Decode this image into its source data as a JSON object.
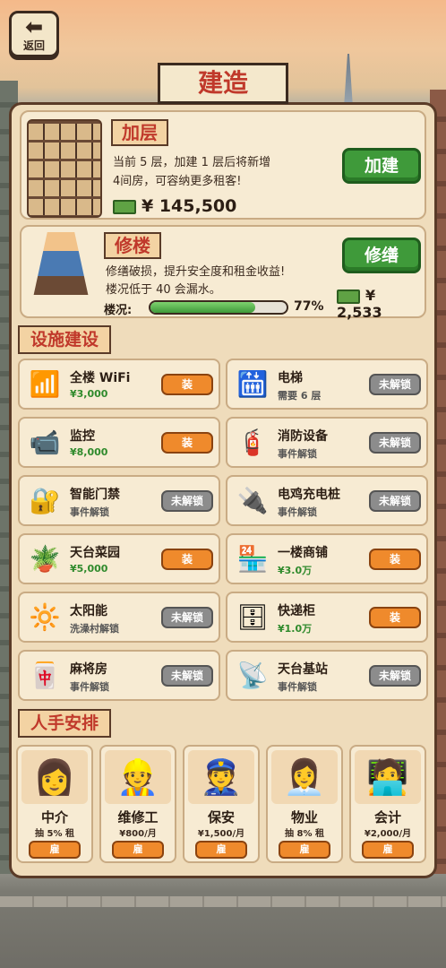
{
  "header": {
    "back_label": "返回",
    "back_icon": "left-arrow-icon",
    "title": "建造"
  },
  "add_floor": {
    "title": "加层",
    "desc_line1": "当前 5 层，加建 1 层后将新增",
    "desc_line2": "4间房，可容纳更多租客!",
    "cost": "¥ 145,500",
    "button": "加建"
  },
  "repair": {
    "title": "修楼",
    "desc_line1": "修缮破损，提升安全度和租金收益!",
    "desc_line2": "楼况低于 40 会漏水。",
    "button": "修缮",
    "cost": "¥ 2,533",
    "condition_label": "楼况:",
    "condition_value": "77%",
    "condition_fraction": 0.77
  },
  "facilities": {
    "section_title": "设施建设",
    "items": [
      {
        "name": "全楼 WiFi",
        "sub": "¥3,000",
        "action": "装",
        "icon": "wifi-router-icon"
      },
      {
        "name": "电梯",
        "sub": "需要 6 层",
        "action": "未解锁",
        "icon": "elevator-icon"
      },
      {
        "name": "监控",
        "sub": "¥8,000",
        "action": "装",
        "icon": "cctv-camera-icon"
      },
      {
        "name": "消防设备",
        "sub": "事件解锁",
        "action": "未解锁",
        "icon": "fire-extinguisher-icon"
      },
      {
        "name": "智能门禁",
        "sub": "事件解锁",
        "action": "未解锁",
        "icon": "smart-lock-icon"
      },
      {
        "name": "电鸡充电桩",
        "sub": "事件解锁",
        "action": "未解锁",
        "icon": "charging-station-icon"
      },
      {
        "name": "天台菜园",
        "sub": "¥5,000",
        "action": "装",
        "icon": "rooftop-garden-icon"
      },
      {
        "name": "一楼商铺",
        "sub": "¥3.0万",
        "action": "装",
        "icon": "storefront-icon"
      },
      {
        "name": "太阳能",
        "sub": "洗澡村解锁",
        "action": "未解锁",
        "icon": "solar-panel-icon"
      },
      {
        "name": "快递柜",
        "sub": "¥1.0万",
        "action": "装",
        "icon": "parcel-locker-icon"
      },
      {
        "name": "麻将房",
        "sub": "事件解锁",
        "action": "未解锁",
        "icon": "mahjong-table-icon"
      },
      {
        "name": "天台基站",
        "sub": "事件解锁",
        "action": "未解锁",
        "icon": "cell-tower-icon"
      }
    ]
  },
  "staff": {
    "section_title": "人手安排",
    "items": [
      {
        "name": "中介",
        "sub": "抽 5% 租",
        "action": "雇",
        "icon": "agent-woman-icon"
      },
      {
        "name": "维修工",
        "sub": "¥800/月",
        "action": "雇",
        "icon": "repairman-icon"
      },
      {
        "name": "保安",
        "sub": "¥1,500/月",
        "action": "雇",
        "icon": "security-guard-icon"
      },
      {
        "name": "物业",
        "sub": "抽 8% 租",
        "action": "雇",
        "icon": "property-manager-icon"
      },
      {
        "name": "会计",
        "sub": "¥2,000/月",
        "action": "雇",
        "icon": "accountant-icon"
      }
    ]
  },
  "colors": {
    "install": "#ef8a2c",
    "locked": "#8c8c8c",
    "confirm": "#3f9a3a",
    "title_red": "#c0392b"
  }
}
